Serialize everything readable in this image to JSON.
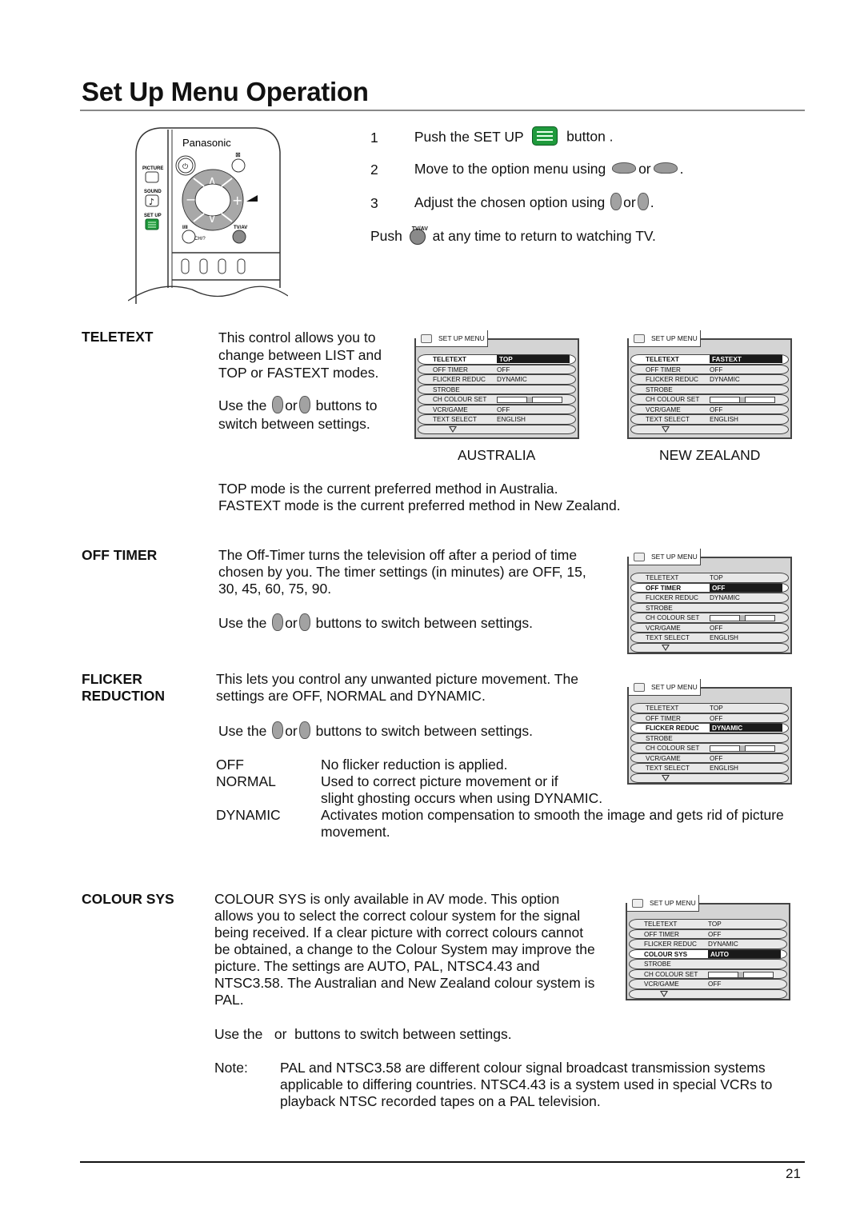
{
  "page": {
    "title": "Set Up Menu Operation",
    "page_number": "21"
  },
  "remote": {
    "brand": "Panasonic",
    "labels": {
      "picture": "PICTURE",
      "sound": "SOUND",
      "setup": "SET UP",
      "power": "I/II",
      "tvav": "TV/AV",
      "mute": "mute",
      "ch": "CH/?"
    },
    "icons": [
      "power-icon",
      "mute-icon",
      "up-arrow-icon",
      "down-arrow-icon",
      "minus-icon",
      "plus-icon",
      "volume-icon",
      "picture-icon",
      "sound-note-icon",
      "setup-menu-icon",
      "tvav-icon"
    ]
  },
  "steps": [
    {
      "num": "1",
      "before": "Push the SET UP",
      "after": "button .",
      "icon": "setup-button-icon"
    },
    {
      "num": "2",
      "before": "Move to the option menu using",
      "mid": "or",
      "after": ".",
      "icon": "up-down-button-icon"
    },
    {
      "num": "3",
      "before": "Adjust the chosen option using",
      "mid": "or",
      "after": ".",
      "icon": "minus-plus-button-icon"
    }
  ],
  "push_tv": {
    "before": "Push",
    "icon_label": "TV/AV",
    "after": "at any time to return to watching TV."
  },
  "sections": {
    "teletext": {
      "heading": "TELETEXT",
      "lines": [
        "This control allows you to",
        "change between LIST and",
        "TOP or FASTEXT modes."
      ],
      "use_line1_a": "Use the",
      "use_line1_or": "or",
      "use_line1_b": "buttons to",
      "use_line2": "switch between settings.",
      "caption_au": "AUSTRALIA",
      "caption_nz": "NEW ZEALAND",
      "note1": "TOP mode is the current preferred method in Australia.",
      "note2": "FASTEXT mode is the current preferred method in New Zealand."
    },
    "off_timer": {
      "heading": "OFF TIMER",
      "lines": [
        "The Off-Timer turns the television off after a period of time",
        "chosen by you. The timer settings (in minutes) are OFF, 15,",
        "30, 45, 60, 75, 90."
      ],
      "use_a": "Use the",
      "use_or": "or",
      "use_b": "buttons to switch between settings."
    },
    "flicker": {
      "heading1": "FLICKER",
      "heading2": "REDUCTION",
      "lines": [
        "This lets you control any unwanted picture movement. The",
        "settings are OFF, NORMAL and DYNAMIC."
      ],
      "use_a": "Use the",
      "use_or": "or",
      "use_b": "buttons to switch between settings.",
      "options": [
        {
          "term": "OFF",
          "desc": [
            "No flicker reduction is applied."
          ]
        },
        {
          "term": "NORMAL",
          "desc": [
            "Used to correct picture movement or if",
            "slight ghosting occurs when using DYNAMIC."
          ]
        },
        {
          "term": "DYNAMIC",
          "desc": [
            "Activates motion compensation to smooth the image and gets rid of picture",
            "movement."
          ]
        }
      ]
    },
    "colour_sys": {
      "heading": "COLOUR SYS",
      "lines": [
        "COLOUR SYS is only available in AV mode. This option",
        "allows you to select the correct colour system for the signal",
        "being received. If a clear picture with correct colours cannot",
        "be obtained, a change to the Colour System may improve the",
        "picture. The settings are AUTO, PAL, NTSC4.43 and",
        "NTSC3.58. The Australian and New Zealand colour system is",
        "PAL."
      ],
      "use_line": "Use the   or  buttons to switch between settings.",
      "note_label": "Note:",
      "note_lines": [
        "PAL and NTSC3.58 are different colour signal broadcast transmission systems",
        "applicable to differing countries. NTSC4.43 is a system used in special VCRs to",
        "playback NTSC recorded tapes on a PAL television."
      ]
    }
  },
  "menus": {
    "tab_label": "SET UP MENU",
    "teletext_au": {
      "rows": [
        {
          "label": "TELETEXT",
          "value": "TOP",
          "selected": true
        },
        {
          "label": "OFF TIMER",
          "value": "OFF"
        },
        {
          "label": "FLICKER REDUC",
          "value": "DYNAMIC"
        },
        {
          "label": "STROBE",
          "value": ""
        },
        {
          "label": "CH COLOUR SET",
          "slider": 0.5
        },
        {
          "label": "VCR/GAME",
          "value": "OFF"
        },
        {
          "label": "TEXT SELECT",
          "value": "ENGLISH"
        },
        {
          "more": true
        }
      ]
    },
    "teletext_nz": {
      "rows": [
        {
          "label": "TELETEXT",
          "value": "FASTEXT",
          "selected": true
        },
        {
          "label": "OFF TIMER",
          "value": "OFF"
        },
        {
          "label": "FLICKER REDUC",
          "value": "DYNAMIC"
        },
        {
          "label": "STROBE",
          "value": ""
        },
        {
          "label": "CH COLOUR SET",
          "slider": 0.5
        },
        {
          "label": "VCR/GAME",
          "value": "OFF"
        },
        {
          "label": "TEXT SELECT",
          "value": "ENGLISH"
        },
        {
          "more": true
        }
      ]
    },
    "off_timer": {
      "rows": [
        {
          "label": "TELETEXT",
          "value": "TOP"
        },
        {
          "label": "OFF TIMER",
          "value": "OFF",
          "selected": true
        },
        {
          "label": "FLICKER REDUC",
          "value": "DYNAMIC"
        },
        {
          "label": "STROBE",
          "value": ""
        },
        {
          "label": "CH COLOUR SET",
          "slider": 0.5
        },
        {
          "label": "VCR/GAME",
          "value": "OFF"
        },
        {
          "label": "TEXT SELECT",
          "value": "ENGLISH"
        },
        {
          "more": true
        }
      ]
    },
    "flicker": {
      "rows": [
        {
          "label": "TELETEXT",
          "value": "TOP"
        },
        {
          "label": "OFF TIMER",
          "value": "OFF"
        },
        {
          "label": "FLICKER REDUC",
          "value": "DYNAMIC",
          "selected": true
        },
        {
          "label": "STROBE",
          "value": ""
        },
        {
          "label": "CH COLOUR SET",
          "slider": 0.5
        },
        {
          "label": "VCR/GAME",
          "value": "OFF"
        },
        {
          "label": "TEXT SELECT",
          "value": "ENGLISH"
        },
        {
          "more": true
        }
      ]
    },
    "colour_sys": {
      "rows": [
        {
          "label": "TELETEXT",
          "value": "TOP"
        },
        {
          "label": "OFF TIMER",
          "value": "OFF"
        },
        {
          "label": "FLICKER REDUC",
          "value": "DYNAMIC"
        },
        {
          "label": "COLOUR SYS",
          "value": "AUTO",
          "selected": true
        },
        {
          "label": "STROBE",
          "value": ""
        },
        {
          "label": "CH COLOUR SET",
          "slider": 0.5
        },
        {
          "label": "VCR/GAME",
          "value": "OFF"
        },
        {
          "more": true
        }
      ]
    }
  }
}
